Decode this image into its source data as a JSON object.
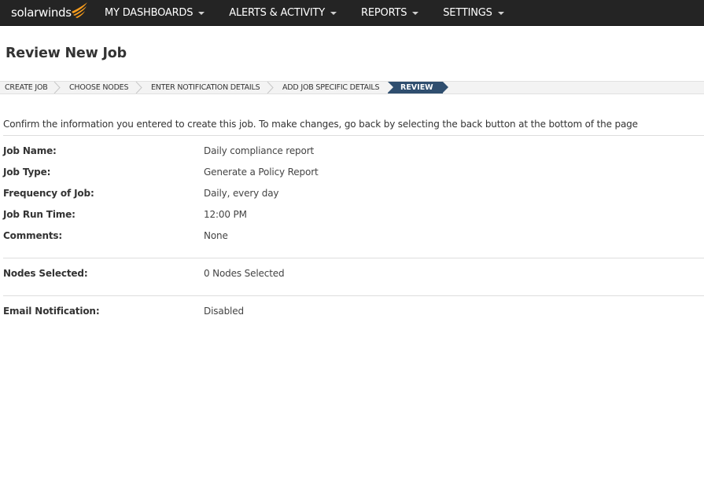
{
  "topbar": {
    "logo_text": "solarwinds",
    "brand_color": "#f99d1c",
    "menu": [
      {
        "label": "MY DASHBOARDS"
      },
      {
        "label": "ALERTS & ACTIVITY"
      },
      {
        "label": "REPORTS"
      },
      {
        "label": "SETTINGS"
      }
    ]
  },
  "page": {
    "title": "Review New Job"
  },
  "wizard": {
    "steps": [
      {
        "label": "CREATE JOB"
      },
      {
        "label": "CHOOSE NODES"
      },
      {
        "label": "ENTER NOTIFICATION DETAILS"
      },
      {
        "label": "ADD JOB SPECIFIC DETAILS"
      },
      {
        "label": "REVIEW"
      }
    ],
    "active_index": 4,
    "active_color": "#2f4e6f"
  },
  "review": {
    "intro": "Confirm the information you entered to create this job. To make changes, go back by selecting the back button at the bottom of the page",
    "details": [
      {
        "label": "Job Name:",
        "value": "Daily compliance report"
      },
      {
        "label": "Job Type:",
        "value": "Generate a Policy Report"
      },
      {
        "label": "Frequency of Job:",
        "value": "Daily, every day"
      },
      {
        "label": "Job Run Time:",
        "value": "12:00 PM"
      },
      {
        "label": "Comments:",
        "value": "None"
      }
    ],
    "nodes": {
      "label": "Nodes Selected:",
      "value": "0 Nodes Selected"
    },
    "email": {
      "label": "Email Notification:",
      "value": "Disabled"
    }
  }
}
